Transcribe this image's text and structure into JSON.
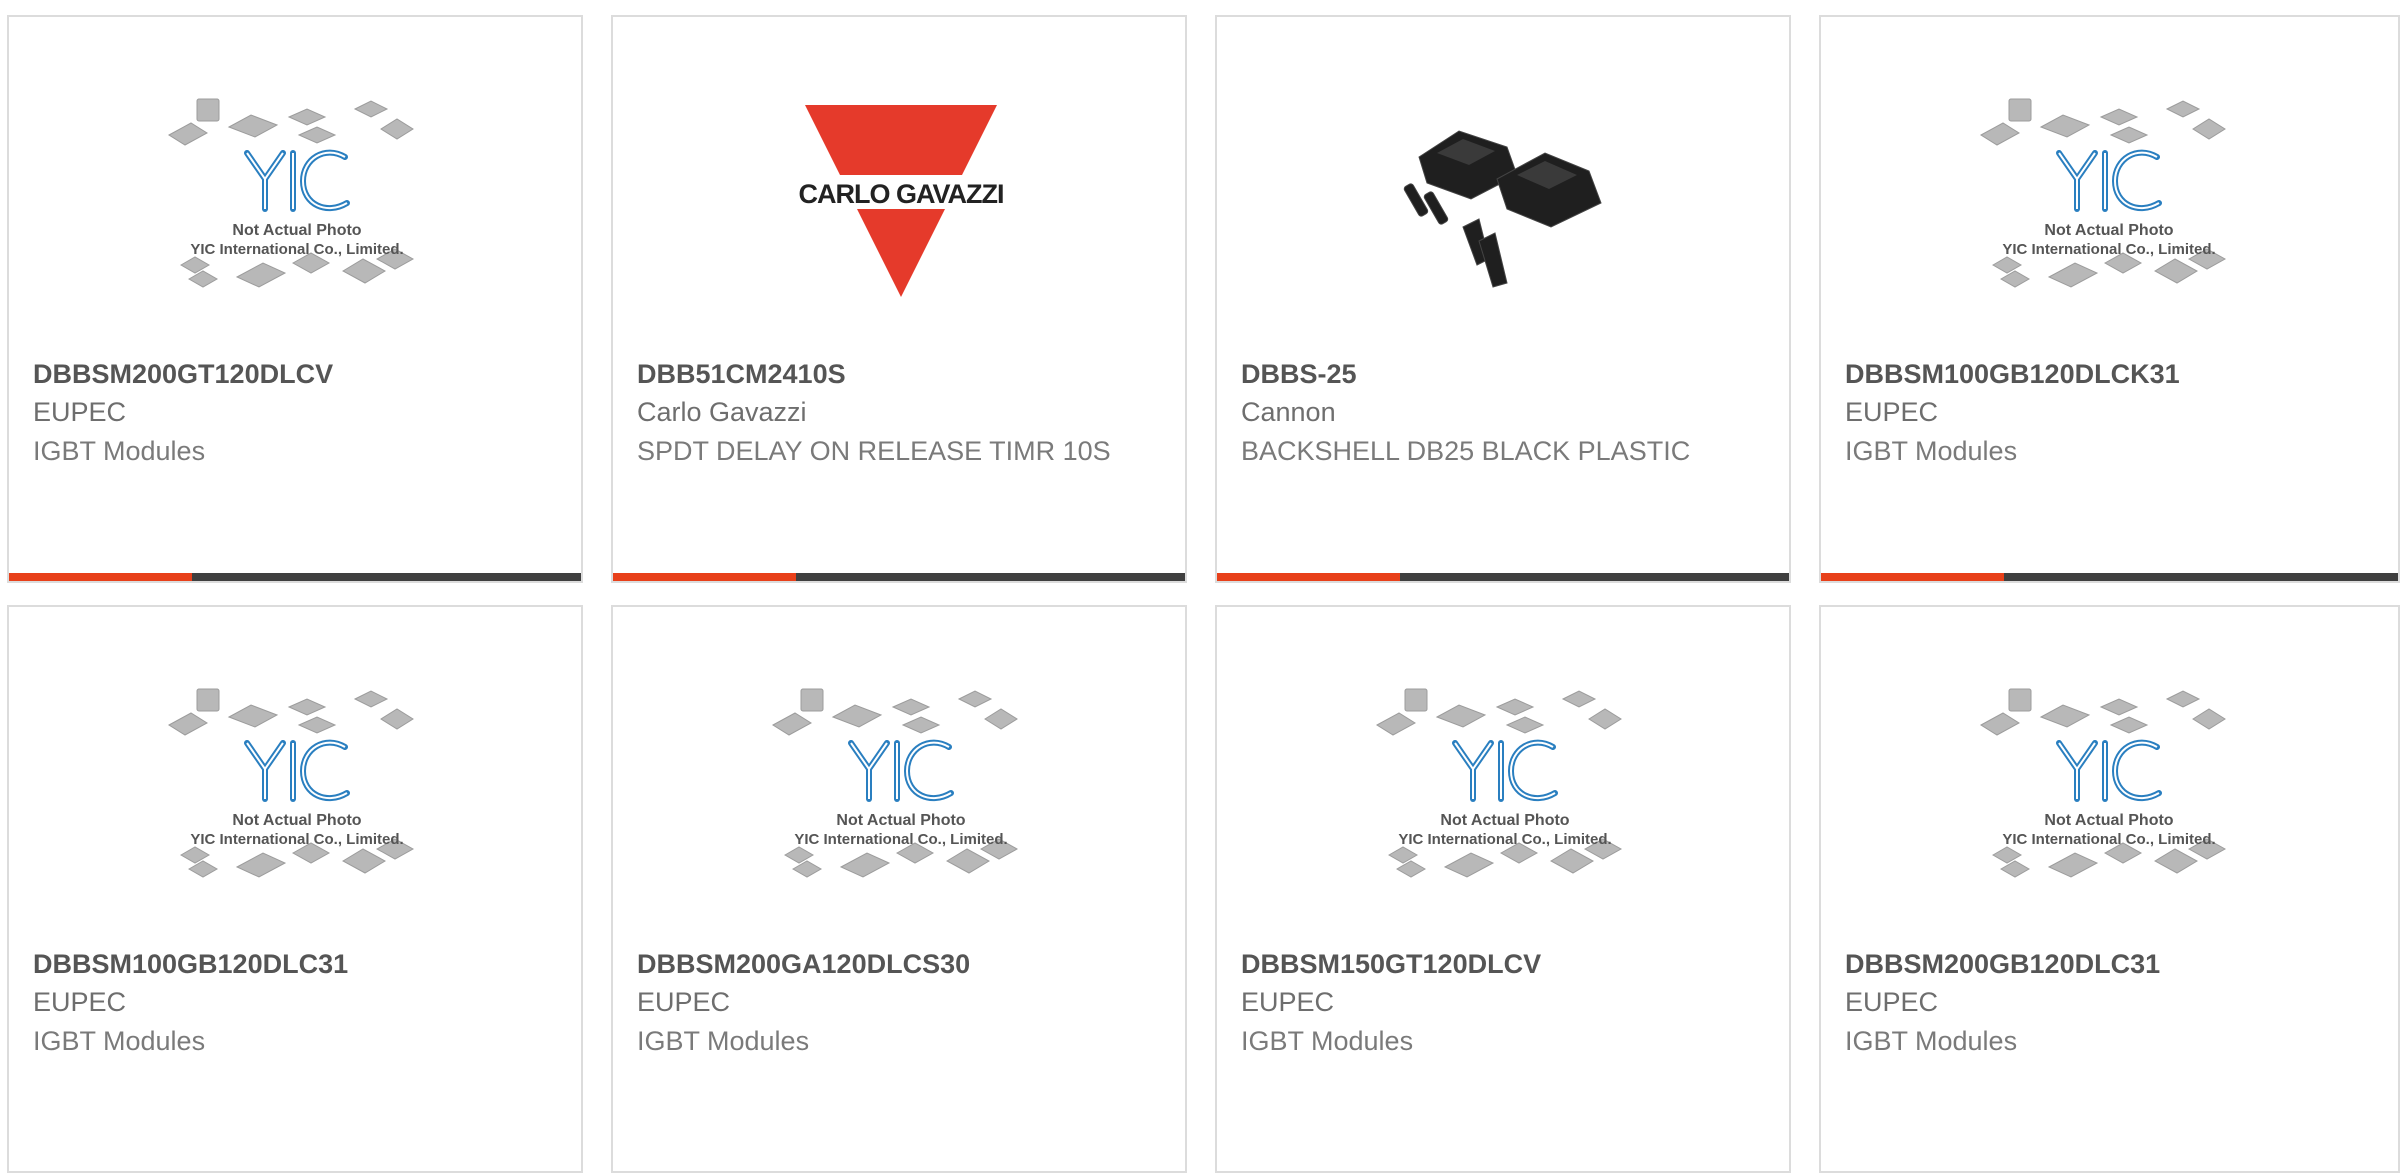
{
  "colors": {
    "accent": "#e8401a",
    "bar": "#3f3f3f",
    "border": "#dcdcdc",
    "yic_blue": "#2a7fc0",
    "carlo_red": "#e53a2b"
  },
  "placeholder_caption": {
    "line1": "Not Actual Photo",
    "line2": "YIC International Co., Limited."
  },
  "brand_logo_text": "CARLO GAVAZZI",
  "products": [
    {
      "part": "DBBSM200GT120DLCV",
      "manufacturer": "EUPEC",
      "description": "IGBT Modules",
      "image": "yic-placeholder"
    },
    {
      "part": "DBB51CM2410S",
      "manufacturer": "Carlo Gavazzi",
      "description": "SPDT DELAY ON RELEASE TIMR 10S",
      "image": "carlo-gavazzi-logo"
    },
    {
      "part": "DBBS-25",
      "manufacturer": "Cannon",
      "description": "BACKSHELL DB25 BLACK PLASTIC",
      "image": "backshell-photo"
    },
    {
      "part": "DBBSM100GB120DLCK31",
      "manufacturer": "EUPEC",
      "description": "IGBT Modules",
      "image": "yic-placeholder"
    },
    {
      "part": "DBBSM100GB120DLC31",
      "manufacturer": "EUPEC",
      "description": "IGBT Modules",
      "image": "yic-placeholder"
    },
    {
      "part": "DBBSM200GA120DLCS30",
      "manufacturer": "EUPEC",
      "description": "IGBT Modules",
      "image": "yic-placeholder"
    },
    {
      "part": "DBBSM150GT120DLCV",
      "manufacturer": "EUPEC",
      "description": "IGBT Modules",
      "image": "yic-placeholder"
    },
    {
      "part": "DBBSM200GB120DLC31",
      "manufacturer": "EUPEC",
      "description": "IGBT Modules",
      "image": "yic-placeholder"
    }
  ]
}
